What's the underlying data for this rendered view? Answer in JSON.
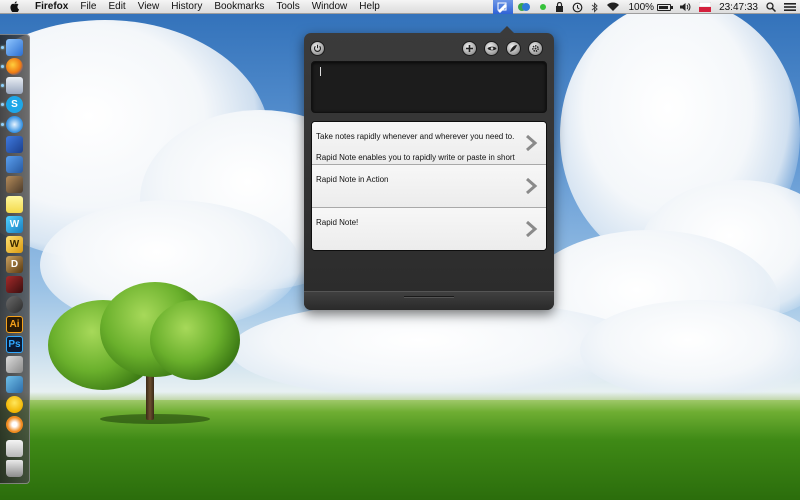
{
  "menubar": {
    "apple_icon": "apple-icon",
    "app_name": "Firefox",
    "menus": [
      "File",
      "Edit",
      "View",
      "History",
      "Bookmarks",
      "Tools",
      "Window",
      "Help"
    ],
    "status": {
      "battery": "100%",
      "clock": "23:47:33",
      "status_icons": [
        "rapid-note-icon",
        "creative-cloud-icon",
        "status-dot-icon",
        "lock-icon",
        "time-machine-icon",
        "bluetooth-icon",
        "wifi-icon",
        "battery-icon",
        "volume-icon",
        "flag-icon",
        "spotlight-icon",
        "notification-icon"
      ]
    }
  },
  "dock": {
    "apps": [
      {
        "name": "finder",
        "glyph": ""
      },
      {
        "name": "firefox",
        "glyph": ""
      },
      {
        "name": "preview",
        "glyph": ""
      },
      {
        "name": "skype",
        "glyph": "S"
      },
      {
        "name": "safari",
        "glyph": ""
      },
      {
        "name": "xcode",
        "glyph": ""
      },
      {
        "name": "notes",
        "glyph": ""
      },
      {
        "name": "iphoto",
        "glyph": ""
      },
      {
        "name": "stickies",
        "glyph": ""
      },
      {
        "name": "word",
        "glyph": "W"
      },
      {
        "name": "wikipedia",
        "glyph": "W"
      },
      {
        "name": "dictionary",
        "glyph": "D"
      },
      {
        "name": "photo-booth",
        "glyph": ""
      },
      {
        "name": "steam",
        "glyph": ""
      },
      {
        "name": "illustrator",
        "glyph": "Ai"
      },
      {
        "name": "photoshop",
        "glyph": "Ps"
      },
      {
        "name": "script-editor",
        "glyph": ""
      },
      {
        "name": "image-capture",
        "glyph": ""
      },
      {
        "name": "adium",
        "glyph": ""
      },
      {
        "name": "blender",
        "glyph": ""
      },
      {
        "name": "documents",
        "glyph": ""
      },
      {
        "name": "trash",
        "glyph": ""
      }
    ]
  },
  "rapid_note": {
    "toolbar": [
      "power-icon",
      "add-icon",
      "eye-icon",
      "feather-icon",
      "settings-gear-icon"
    ],
    "input_value": "",
    "notes": [
      {
        "line1": "Take notes rapidly whenever and wherever you need to.",
        "line2": "Rapid Note enables you to rapidly write or paste in short"
      },
      {
        "line1": "Rapid Note in Action",
        "line2": ""
      },
      {
        "line1": "Rapid Note!",
        "line2": ""
      }
    ]
  },
  "colors": {
    "menubar": "#e6e6e6",
    "status_highlight": "#2f63d6",
    "popup": "#2f2f2f",
    "list_bg": "#f1f1f1",
    "chevron": "#8a8a8a"
  }
}
